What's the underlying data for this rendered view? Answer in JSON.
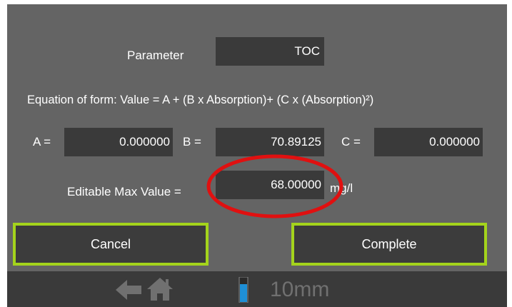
{
  "parameter": {
    "label": "Parameter",
    "value": "TOC"
  },
  "equation": {
    "text": "Equation of form: Value = A + (B x Absorption)+ (C x (Absorption)²)"
  },
  "coefficients": {
    "a_label": "A =",
    "a_value": "0.000000",
    "b_label": "B =",
    "b_value": "70.89125",
    "c_label": "C =",
    "c_value": "0.000000"
  },
  "max_value": {
    "label": "Editable Max Value =",
    "value": "68.00000",
    "unit": "mg/l"
  },
  "buttons": {
    "cancel": "Cancel",
    "complete": "Complete"
  },
  "status_bar": {
    "cell_size": "10mm",
    "icons": [
      "back-arrow-icon",
      "home-icon",
      "cuvette-icon"
    ]
  },
  "colors": {
    "background": "#646464",
    "box": "#3a3a3a",
    "button_border": "#a4d41c",
    "highlight": "#e01010",
    "cuvette": "#1e8fd6"
  }
}
